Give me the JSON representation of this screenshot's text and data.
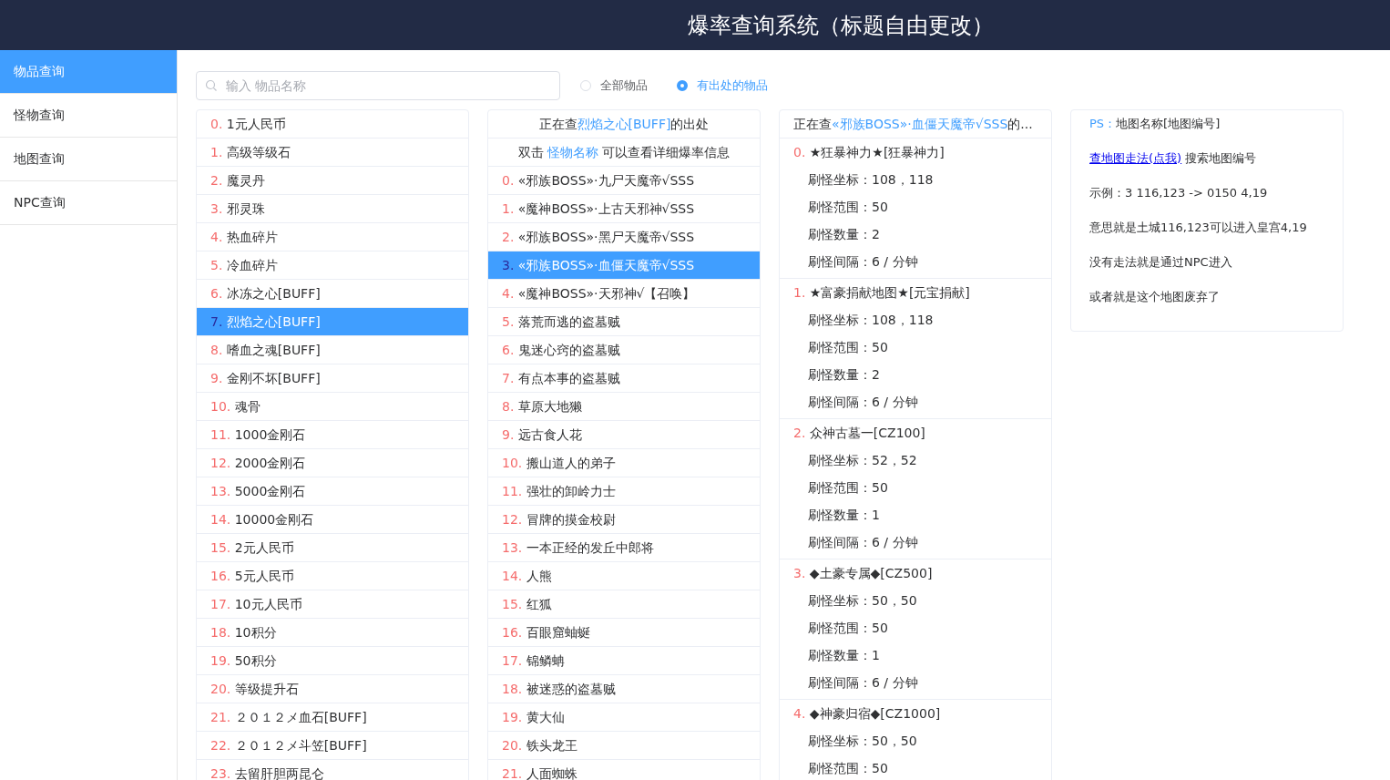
{
  "header": {
    "title": "爆率查询系统（标题自由更改）"
  },
  "sidebar": {
    "items": [
      {
        "label": "物品查询",
        "selected": true
      },
      {
        "label": "怪物查询",
        "selected": false
      },
      {
        "label": "地图查询",
        "selected": false
      },
      {
        "label": "NPC查询",
        "selected": false
      }
    ]
  },
  "search": {
    "placeholder": "输入 物品名称"
  },
  "filter": [
    {
      "label": "全部物品",
      "selected": false
    },
    {
      "label": "有出处的物品",
      "selected": true
    }
  ],
  "items": [
    {
      "index": "0.",
      "name": "1元人民币",
      "selected": false
    },
    {
      "index": "1.",
      "name": "高级等级石",
      "selected": false
    },
    {
      "index": "2.",
      "name": "魔灵丹",
      "selected": false
    },
    {
      "index": "3.",
      "name": "邪灵珠",
      "selected": false
    },
    {
      "index": "4.",
      "name": "热血碎片",
      "selected": false
    },
    {
      "index": "5.",
      "name": "冷血碎片",
      "selected": false
    },
    {
      "index": "6.",
      "name": "冰冻之心[BUFF]",
      "selected": false
    },
    {
      "index": "7.",
      "name": "烈焰之心[BUFF]",
      "selected": true
    },
    {
      "index": "8.",
      "name": "嗜血之魂[BUFF]",
      "selected": false
    },
    {
      "index": "9.",
      "name": "金刚不坏[BUFF]",
      "selected": false
    },
    {
      "index": "10.",
      "name": "魂骨",
      "selected": false
    },
    {
      "index": "11.",
      "name": "1000金刚石",
      "selected": false
    },
    {
      "index": "12.",
      "name": "2000金刚石",
      "selected": false
    },
    {
      "index": "13.",
      "name": "5000金刚石",
      "selected": false
    },
    {
      "index": "14.",
      "name": "10000金刚石",
      "selected": false
    },
    {
      "index": "15.",
      "name": "2元人民币",
      "selected": false
    },
    {
      "index": "16.",
      "name": "5元人民币",
      "selected": false
    },
    {
      "index": "17.",
      "name": "10元人民币",
      "selected": false
    },
    {
      "index": "18.",
      "name": "10积分",
      "selected": false
    },
    {
      "index": "19.",
      "name": "50积分",
      "selected": false
    },
    {
      "index": "20.",
      "name": "等级提升石",
      "selected": false
    },
    {
      "index": "21.",
      "name": "２０１２メ血石[BUFF]",
      "selected": false
    },
    {
      "index": "22.",
      "name": "２０１２メ斗笠[BUFF]",
      "selected": false
    },
    {
      "index": "23.",
      "name": "去留肝胆两昆仑",
      "selected": false
    }
  ],
  "sources": {
    "heading": {
      "prefix": "正在查",
      "highlight": "烈焰之心[BUFF]",
      "suffix": "的出处"
    },
    "hint": {
      "prefix": "双击 ",
      "highlight": "怪物名称",
      "suffix": " 可以查看详细爆率信息"
    },
    "monsters": [
      {
        "index": "0.",
        "name": "«邪族BOSS»·九尸天魔帝√SSS",
        "selected": false
      },
      {
        "index": "1.",
        "name": "«魔神BOSS»·上古天邪神√SSS",
        "selected": false
      },
      {
        "index": "2.",
        "name": "«邪族BOSS»·黑尸天魔帝√SSS",
        "selected": false
      },
      {
        "index": "3.",
        "name": "«邪族BOSS»·血僵天魔帝√SSS",
        "selected": true
      },
      {
        "index": "4.",
        "name": "«魔神BOSS»·天邪神√【召唤】",
        "selected": false
      },
      {
        "index": "5.",
        "name": "落荒而逃的盗墓贼",
        "selected": false
      },
      {
        "index": "6.",
        "name": "鬼迷心窍的盗墓贼",
        "selected": false
      },
      {
        "index": "7.",
        "name": "有点本事的盗墓贼",
        "selected": false
      },
      {
        "index": "8.",
        "name": "草原大地獭",
        "selected": false
      },
      {
        "index": "9.",
        "name": "远古食人花",
        "selected": false
      },
      {
        "index": "10.",
        "name": "搬山道人的弟子",
        "selected": false
      },
      {
        "index": "11.",
        "name": "强壮的卸岭力士",
        "selected": false
      },
      {
        "index": "12.",
        "name": "冒牌的摸金校尉",
        "selected": false
      },
      {
        "index": "13.",
        "name": "一本正经的发丘中郎将",
        "selected": false
      },
      {
        "index": "14.",
        "name": "人熊",
        "selected": false
      },
      {
        "index": "15.",
        "name": "红狐",
        "selected": false
      },
      {
        "index": "16.",
        "name": "百眼窟蚰蜒",
        "selected": false
      },
      {
        "index": "17.",
        "name": "锦鳞蚺",
        "selected": false
      },
      {
        "index": "18.",
        "name": "被迷惑的盗墓贼",
        "selected": false
      },
      {
        "index": "19.",
        "name": "黄大仙",
        "selected": false
      },
      {
        "index": "20.",
        "name": "铁头龙王",
        "selected": false
      },
      {
        "index": "21.",
        "name": "人面蜘蛛",
        "selected": false
      }
    ]
  },
  "spawns": {
    "heading": {
      "prefix": "正在查",
      "highlight": "«邪族BOSS»·血僵天魔帝√SSS",
      "suffix": "的..."
    },
    "maps": [
      {
        "index": "0.",
        "title": "★狂暴神力★[狂暴神力]",
        "fields": [
          "刷怪坐标：108，118",
          "刷怪范围：50",
          "刷怪数量：2",
          "刷怪间隔：6 / 分钟"
        ]
      },
      {
        "index": "1.",
        "title": "★富豪捐献地图★[元宝捐献]",
        "fields": [
          "刷怪坐标：108，118",
          "刷怪范围：50",
          "刷怪数量：2",
          "刷怪间隔：6 / 分钟"
        ]
      },
      {
        "index": "2.",
        "title": "众神古墓一[CZ100]",
        "fields": [
          "刷怪坐标：52，52",
          "刷怪范围：50",
          "刷怪数量：1",
          "刷怪间隔：6 / 分钟"
        ]
      },
      {
        "index": "3.",
        "title": "◆土豪专属◆[CZ500]",
        "fields": [
          "刷怪坐标：50，50",
          "刷怪范围：50",
          "刷怪数量：1",
          "刷怪间隔：6 / 分钟"
        ]
      },
      {
        "index": "4.",
        "title": "◆神豪归宿◆[CZ1000]",
        "fields": [
          "刷怪坐标：50，50",
          "刷怪范围：50"
        ]
      }
    ]
  },
  "notes": {
    "ps_label": "PS：",
    "ps_text": "地图名称[地图编号]",
    "link": "查地图走法(点我)",
    "link_suffix": " 搜索地图编号",
    "lines": [
      "示例：3 116,123 -> 0150 4,19",
      "意思就是土城116,123可以进入皇宫4,19",
      "没有走法就是通过NPC进入",
      "或者就是这个地图废弃了"
    ]
  }
}
